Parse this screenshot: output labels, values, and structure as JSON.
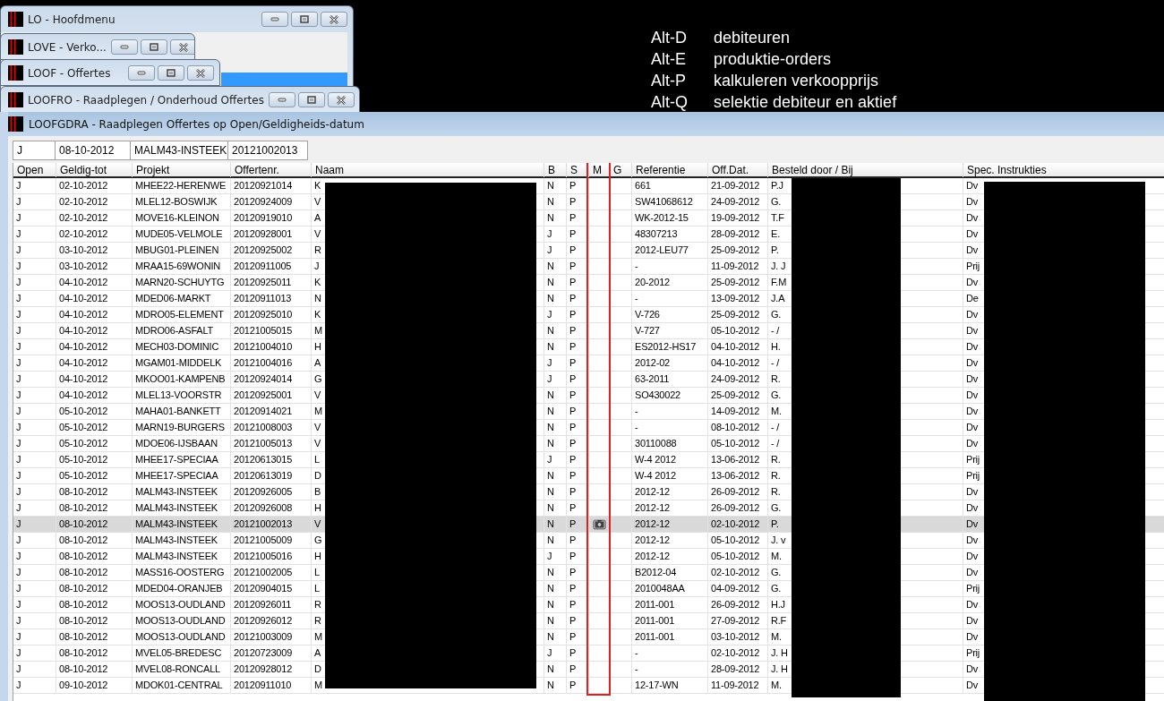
{
  "background_windows": [
    {
      "title": "LO - Hoofdmenu",
      "kind": "menu"
    },
    {
      "title": "LOVE - Verko...",
      "kind": "plain"
    },
    {
      "title": "LOOF - Offertes",
      "kind": "plain"
    },
    {
      "title": "LOOFRO - Raadplegen / Onderhoud Offertes",
      "kind": "plain"
    }
  ],
  "shortcuts": [
    {
      "key": "Alt-D",
      "label": "debiteuren"
    },
    {
      "key": "Alt-E",
      "label": "produktie-orders"
    },
    {
      "key": "Alt-P",
      "label": "kalkuleren verkoopprijs"
    },
    {
      "key": "Alt-Q",
      "label": "selektie debiteur en aktief"
    }
  ],
  "window": {
    "title": "LOOFGDRA - Raadplegen Offertes op Open/Geldigheids-datum"
  },
  "filter": [
    "J",
    "08-10-2012",
    "MALM43-INSTEEK",
    "20121002013"
  ],
  "table": {
    "columns": [
      {
        "label": "Open",
        "kind": "text",
        "highlighted": false
      },
      {
        "label": "Geldig-tot",
        "kind": "text",
        "highlighted": false
      },
      {
        "label": "Projekt",
        "kind": "text",
        "highlighted": false
      },
      {
        "label": "Offertenr.",
        "kind": "text",
        "highlighted": false
      },
      {
        "label": "Naam",
        "kind": "text",
        "highlighted": false
      },
      {
        "label": "B",
        "kind": "text",
        "highlighted": false
      },
      {
        "label": "S",
        "kind": "text",
        "highlighted": false
      },
      {
        "label": "M",
        "kind": "photo",
        "highlighted": true
      },
      {
        "label": "G",
        "kind": "blank",
        "highlighted": false
      },
      {
        "label": "Referentie",
        "kind": "text",
        "highlighted": false
      },
      {
        "label": "Off.Dat.",
        "kind": "text",
        "highlighted": false
      },
      {
        "label": "Besteld door / Bij",
        "kind": "text",
        "highlighted": false
      },
      {
        "label": "Spec. Instrukties",
        "kind": "text",
        "highlighted": false
      }
    ],
    "rows": [
      {
        "cells": [
          "J",
          "02-10-2012",
          "MHEE22-HERENWE",
          "20120921014",
          "K",
          "N",
          "P",
          "",
          "",
          "661",
          "21-09-2012",
          "P.J",
          "Dv"
        ],
        "photo": false,
        "selected": false
      },
      {
        "cells": [
          "J",
          "02-10-2012",
          "MLEL12-BOSWIJK",
          "20120924009",
          "V",
          "N",
          "P",
          "",
          "",
          "SW41068612",
          "24-09-2012",
          "G.",
          "Dv"
        ],
        "photo": false,
        "selected": false
      },
      {
        "cells": [
          "J",
          "02-10-2012",
          "MOVE16-KLEINON",
          "20120919010",
          "A",
          "N",
          "P",
          "",
          "",
          "WK-2012-15",
          "19-09-2012",
          "T.F",
          "Dv"
        ],
        "photo": false,
        "selected": false
      },
      {
        "cells": [
          "J",
          "02-10-2012",
          "MUDE05-VELMOLE",
          "20120928001",
          "V",
          "J",
          "P",
          "",
          "",
          "48307213",
          "28-09-2012",
          "E.",
          "Dv"
        ],
        "photo": false,
        "selected": false
      },
      {
        "cells": [
          "J",
          "03-10-2012",
          "MBUG01-PLEINEN",
          "20120925002",
          "R",
          "J",
          "P",
          "",
          "",
          "2012-LEU77",
          "25-09-2012",
          "P.",
          "Dv"
        ],
        "photo": false,
        "selected": false
      },
      {
        "cells": [
          "J",
          "03-10-2012",
          "MRAA15-69WONIN",
          "20120911005",
          "J",
          "N",
          "P",
          "",
          "",
          "-",
          "11-09-2012",
          "J. J",
          "Prij"
        ],
        "photo": false,
        "selected": false
      },
      {
        "cells": [
          "J",
          "04-10-2012",
          "MARN20-SCHUYTG",
          "20120925011",
          "K",
          "N",
          "P",
          "",
          "",
          "20-2012",
          "25-09-2012",
          "F.M",
          "Dv"
        ],
        "photo": false,
        "selected": false
      },
      {
        "cells": [
          "J",
          "04-10-2012",
          "MDED06-MARKT",
          "20120911013",
          "N",
          "N",
          "P",
          "",
          "",
          "-",
          "13-09-2012",
          "J.A",
          "De"
        ],
        "photo": false,
        "selected": false
      },
      {
        "cells": [
          "J",
          "04-10-2012",
          "MDRO05-ELEMENT",
          "20120925010",
          "K",
          "J",
          "P",
          "",
          "",
          "V-726",
          "25-09-2012",
          "G.",
          "Dv"
        ],
        "photo": false,
        "selected": false
      },
      {
        "cells": [
          "J",
          "04-10-2012",
          "MDRO06-ASFALT",
          "20121005015",
          "M",
          "N",
          "P",
          "",
          "",
          "V-727",
          "05-10-2012",
          "- /",
          "Dv"
        ],
        "photo": false,
        "selected": false
      },
      {
        "cells": [
          "J",
          "04-10-2012",
          "MECH03-DOMINIC",
          "20121004010",
          "H",
          "N",
          "P",
          "",
          "",
          "ES2012-HS17",
          "04-10-2012",
          "H.",
          "Dv"
        ],
        "photo": false,
        "selected": false
      },
      {
        "cells": [
          "J",
          "04-10-2012",
          "MGAM01-MIDDELK",
          "20121004016",
          "A",
          "J",
          "P",
          "",
          "",
          "2012-02",
          "04-10-2012",
          "- /",
          "Dv"
        ],
        "photo": false,
        "selected": false
      },
      {
        "cells": [
          "J",
          "04-10-2012",
          "MKOO01-KAMPENB",
          "20120924014",
          "G",
          "J",
          "P",
          "",
          "",
          "63-2011",
          "24-09-2012",
          "R.",
          "Dv"
        ],
        "photo": false,
        "selected": false
      },
      {
        "cells": [
          "J",
          "04-10-2012",
          "MLEL13-VOORSTR",
          "20120925001",
          "V",
          "N",
          "P",
          "",
          "",
          "SO430022",
          "25-09-2012",
          "G.",
          "Dv"
        ],
        "photo": false,
        "selected": false
      },
      {
        "cells": [
          "J",
          "05-10-2012",
          "MAHA01-BANKETT",
          "20120914021",
          "M",
          "N",
          "P",
          "",
          "",
          "-",
          "14-09-2012",
          "M.",
          "Dv"
        ],
        "photo": false,
        "selected": false
      },
      {
        "cells": [
          "J",
          "05-10-2012",
          "MARN19-BURGERS",
          "20121008003",
          "V",
          "N",
          "P",
          "",
          "",
          "-",
          "08-10-2012",
          "- /",
          "Dv"
        ],
        "photo": false,
        "selected": false
      },
      {
        "cells": [
          "J",
          "05-10-2012",
          "MDOE06-IJSBAAN",
          "20121005013",
          "V",
          "N",
          "P",
          "",
          "",
          "30110088",
          "05-10-2012",
          "- /",
          "Dv"
        ],
        "photo": false,
        "selected": false
      },
      {
        "cells": [
          "J",
          "05-10-2012",
          "MHEE17-SPECIAA",
          "20120613015",
          "L",
          "J",
          "P",
          "",
          "",
          "W-4 2012",
          "13-06-2012",
          "R.",
          "Prij"
        ],
        "photo": false,
        "selected": false
      },
      {
        "cells": [
          "J",
          "05-10-2012",
          "MHEE17-SPECIAA",
          "20120613019",
          "D",
          "N",
          "P",
          "",
          "",
          "W-4 2012",
          "13-06-2012",
          "R.",
          "Prij"
        ],
        "photo": false,
        "selected": false
      },
      {
        "cells": [
          "J",
          "08-10-2012",
          "MALM43-INSTEEK",
          "20120926005",
          "B",
          "N",
          "P",
          "",
          "",
          "2012-12",
          "26-09-2012",
          "R.",
          "Dv"
        ],
        "photo": false,
        "selected": false
      },
      {
        "cells": [
          "J",
          "08-10-2012",
          "MALM43-INSTEEK",
          "20120926008",
          "H",
          "N",
          "P",
          "",
          "",
          "2012-12",
          "26-09-2012",
          "G.",
          "Dv"
        ],
        "photo": false,
        "selected": false
      },
      {
        "cells": [
          "J",
          "08-10-2012",
          "MALM43-INSTEEK",
          "20121002013",
          "V",
          "N",
          "P",
          "",
          "",
          "2012-12",
          "02-10-2012",
          "P.",
          "Dv"
        ],
        "photo": true,
        "selected": true
      },
      {
        "cells": [
          "J",
          "08-10-2012",
          "MALM43-INSTEEK",
          "20121005009",
          "G",
          "N",
          "P",
          "",
          "",
          "2012-12",
          "05-10-2012",
          "J. v",
          "Dv"
        ],
        "photo": false,
        "selected": false
      },
      {
        "cells": [
          "J",
          "08-10-2012",
          "MALM43-INSTEEK",
          "20121005016",
          "H",
          "J",
          "P",
          "",
          "",
          "2012-12",
          "05-10-2012",
          "M.",
          "Dv"
        ],
        "photo": false,
        "selected": false
      },
      {
        "cells": [
          "J",
          "08-10-2012",
          "MASS16-OOSTERG",
          "20121002005",
          "L",
          "N",
          "P",
          "",
          "",
          "B2012-04",
          "02-10-2012",
          "G.",
          "Dv"
        ],
        "photo": false,
        "selected": false
      },
      {
        "cells": [
          "J",
          "08-10-2012",
          "MDED04-ORANJEB",
          "20120904015",
          "L",
          "N",
          "P",
          "",
          "",
          "2010048AA",
          "04-09-2012",
          "G.",
          "Prij"
        ],
        "photo": false,
        "selected": false
      },
      {
        "cells": [
          "J",
          "08-10-2012",
          "MOOS13-OUDLAND",
          "20120926011",
          "R",
          "N",
          "P",
          "",
          "",
          "2011-001",
          "26-09-2012",
          "H.J",
          "Dv"
        ],
        "photo": false,
        "selected": false
      },
      {
        "cells": [
          "J",
          "08-10-2012",
          "MOOS13-OUDLAND",
          "20120926012",
          "R",
          "N",
          "P",
          "",
          "",
          "2011-001",
          "27-09-2012",
          "R.F",
          "Dv"
        ],
        "photo": false,
        "selected": false
      },
      {
        "cells": [
          "J",
          "08-10-2012",
          "MOOS13-OUDLAND",
          "20121003009",
          "M",
          "N",
          "P",
          "",
          "",
          "2011-001",
          "03-10-2012",
          "M.",
          "Dv"
        ],
        "photo": false,
        "selected": false
      },
      {
        "cells": [
          "J",
          "08-10-2012",
          "MVEL05-BREDESC",
          "20120723009",
          "A",
          "J",
          "P",
          "",
          "",
          "-",
          "02-10-2012",
          "J. H",
          "Prij"
        ],
        "photo": false,
        "selected": false
      },
      {
        "cells": [
          "J",
          "08-10-2012",
          "MVEL08-RONCALL",
          "20120928012",
          "D",
          "N",
          "P",
          "",
          "",
          "-",
          "28-09-2012",
          "J. H",
          "Dv"
        ],
        "photo": false,
        "selected": false
      },
      {
        "cells": [
          "J",
          "09-10-2012",
          "MDOK01-CENTRAL",
          "20120911010",
          "M",
          "N",
          "P",
          "",
          "",
          "12-17-WN",
          "11-09-2012",
          "M.",
          "Dv"
        ],
        "photo": false,
        "selected": false
      }
    ]
  }
}
